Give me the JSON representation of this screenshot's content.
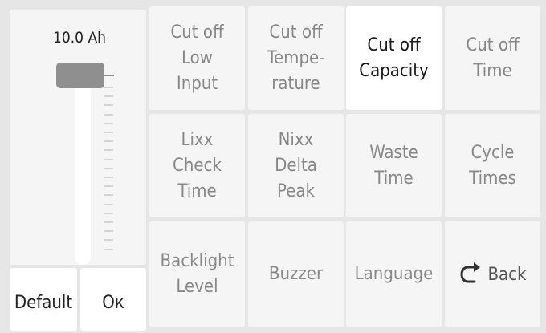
{
  "capacity_panel": {
    "value_label": "10.0 Ah",
    "slider_level_fraction": 1.0,
    "default_label": "Default",
    "ok_label": "Ок"
  },
  "tiles": [
    {
      "label": "Cut off\nLow\nInput",
      "active": false
    },
    {
      "label": "Cut off\nTempe-\nrature",
      "active": false
    },
    {
      "label": "Cut off\nCapacity",
      "active": true
    },
    {
      "label": "Cut off\nTime",
      "active": false
    },
    {
      "label": "Lixx\nCheck\nTime",
      "active": false
    },
    {
      "label": "Nixx\nDelta\nPeak",
      "active": false
    },
    {
      "label": "Waste\nTime",
      "active": false
    },
    {
      "label": "Cycle\nTimes",
      "active": false
    },
    {
      "label": "Backlight\nLevel",
      "active": false
    },
    {
      "label": "Buzzer",
      "active": false
    },
    {
      "label": "Language",
      "active": false
    },
    {
      "label": "Back",
      "active": false,
      "icon": "return-arrow-icon"
    }
  ],
  "colors": {
    "background": "#e6e6e6",
    "tile": "#f5f5f5",
    "tile_active": "#ffffff",
    "text_inactive": "#888888",
    "text_active": "#1a1a1a",
    "slider_knob": "#8f8f8f"
  }
}
